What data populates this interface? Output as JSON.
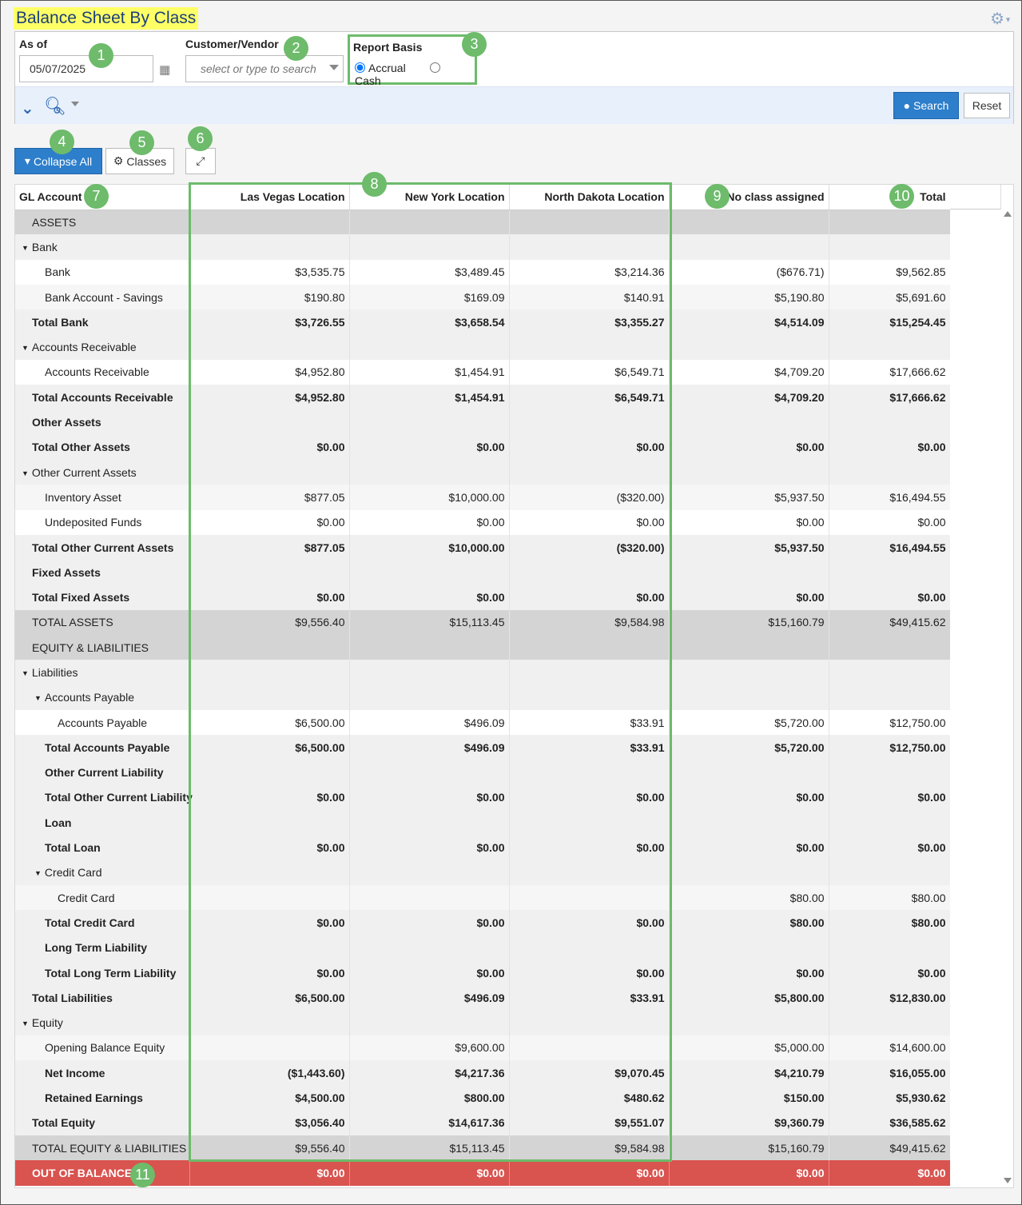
{
  "page": {
    "title": "Balance Sheet By Class"
  },
  "filters": {
    "as_of_label": "As of",
    "as_of_value": "05/07/2025",
    "customer_vendor_label": "Customer/Vendor",
    "customer_vendor_placeholder": "select or type to search",
    "report_basis_label": "Report Basis",
    "basis_options": [
      "Accrual",
      "Cash"
    ],
    "basis_selected": "Accrual",
    "search_label": "Search",
    "reset_label": "Reset"
  },
  "toolbar": {
    "collapse_all_label": "Collapse All",
    "classes_label": "Classes"
  },
  "markers": [
    "1",
    "2",
    "3",
    "4",
    "5",
    "6",
    "7",
    "8",
    "9",
    "10",
    "11"
  ],
  "table": {
    "headers": [
      "GL Account",
      "Las Vegas Location",
      "New York Location",
      "North Dakota Location",
      "No class assigned",
      "Total"
    ],
    "rows": [
      {
        "type": "sec",
        "level": 0,
        "label": "ASSETS",
        "cells": [
          "",
          "",
          "",
          "",
          ""
        ]
      },
      {
        "type": "grp",
        "level": 0,
        "toggle": true,
        "label": "Bank",
        "cells": [
          "",
          "",
          "",
          "",
          ""
        ]
      },
      {
        "type": "line",
        "level": 1,
        "label": "Bank",
        "cells": [
          "$3,535.75",
          "$3,489.45",
          "$3,214.36",
          "($676.71)",
          "$9,562.85"
        ]
      },
      {
        "type": "line alt",
        "level": 1,
        "label": "Bank Account - Savings",
        "cells": [
          "$190.80",
          "$169.09",
          "$140.91",
          "$5,190.80",
          "$5,691.60"
        ]
      },
      {
        "type": "tot",
        "level": 0,
        "label": "Total Bank",
        "cells": [
          "$3,726.55",
          "$3,658.54",
          "$3,355.27",
          "$4,514.09",
          "$15,254.45"
        ]
      },
      {
        "type": "grp",
        "level": 0,
        "toggle": true,
        "label": "Accounts Receivable",
        "cells": [
          "",
          "",
          "",
          "",
          ""
        ]
      },
      {
        "type": "line",
        "level": 1,
        "label": "Accounts Receivable",
        "cells": [
          "$4,952.80",
          "$1,454.91",
          "$6,549.71",
          "$4,709.20",
          "$17,666.62"
        ]
      },
      {
        "type": "tot",
        "level": 0,
        "label": "Total Accounts Receivable",
        "cells": [
          "$4,952.80",
          "$1,454.91",
          "$6,549.71",
          "$4,709.20",
          "$17,666.62"
        ]
      },
      {
        "type": "tot",
        "level": 0,
        "label": "Other Assets",
        "cells": [
          "",
          "",
          "",
          "",
          ""
        ]
      },
      {
        "type": "tot",
        "level": 0,
        "label": "Total Other Assets",
        "cells": [
          "$0.00",
          "$0.00",
          "$0.00",
          "$0.00",
          "$0.00"
        ]
      },
      {
        "type": "grp",
        "level": 0,
        "toggle": true,
        "label": "Other Current Assets",
        "cells": [
          "",
          "",
          "",
          "",
          ""
        ]
      },
      {
        "type": "line alt",
        "level": 1,
        "label": "Inventory Asset",
        "cells": [
          "$877.05",
          "$10,000.00",
          "($320.00)",
          "$5,937.50",
          "$16,494.55"
        ]
      },
      {
        "type": "line",
        "level": 1,
        "label": "Undeposited Funds",
        "cells": [
          "$0.00",
          "$0.00",
          "$0.00",
          "$0.00",
          "$0.00"
        ]
      },
      {
        "type": "tot",
        "level": 0,
        "label": "Total Other Current Assets",
        "cells": [
          "$877.05",
          "$10,000.00",
          "($320.00)",
          "$5,937.50",
          "$16,494.55"
        ]
      },
      {
        "type": "tot",
        "level": 0,
        "label": "Fixed Assets",
        "cells": [
          "",
          "",
          "",
          "",
          ""
        ]
      },
      {
        "type": "tot",
        "level": 0,
        "label": "Total Fixed Assets",
        "cells": [
          "$0.00",
          "$0.00",
          "$0.00",
          "$0.00",
          "$0.00"
        ]
      },
      {
        "type": "grand",
        "level": 0,
        "label": "TOTAL ASSETS",
        "cells": [
          "$9,556.40",
          "$15,113.45",
          "$9,584.98",
          "$15,160.79",
          "$49,415.62"
        ]
      },
      {
        "type": "sec",
        "level": 0,
        "label": "EQUITY & LIABILITIES",
        "cells": [
          "",
          "",
          "",
          "",
          ""
        ]
      },
      {
        "type": "grp",
        "level": 0,
        "toggle": true,
        "label": "Liabilities",
        "cells": [
          "",
          "",
          "",
          "",
          ""
        ]
      },
      {
        "type": "grp",
        "level": 1,
        "toggle": true,
        "label": "Accounts Payable",
        "cells": [
          "",
          "",
          "",
          "",
          ""
        ]
      },
      {
        "type": "line",
        "level": 2,
        "label": "Accounts Payable",
        "cells": [
          "$6,500.00",
          "$496.09",
          "$33.91",
          "$5,720.00",
          "$12,750.00"
        ]
      },
      {
        "type": "tot",
        "level": 1,
        "label": "Total Accounts Payable",
        "cells": [
          "$6,500.00",
          "$496.09",
          "$33.91",
          "$5,720.00",
          "$12,750.00"
        ]
      },
      {
        "type": "tot",
        "level": 1,
        "label": "Other Current Liability",
        "cells": [
          "",
          "",
          "",
          "",
          ""
        ]
      },
      {
        "type": "tot",
        "level": 1,
        "label": "Total Other Current Liability",
        "cells": [
          "$0.00",
          "$0.00",
          "$0.00",
          "$0.00",
          "$0.00"
        ]
      },
      {
        "type": "tot",
        "level": 1,
        "label": "Loan",
        "cells": [
          "",
          "",
          "",
          "",
          ""
        ]
      },
      {
        "type": "tot",
        "level": 1,
        "label": "Total Loan",
        "cells": [
          "$0.00",
          "$0.00",
          "$0.00",
          "$0.00",
          "$0.00"
        ]
      },
      {
        "type": "grp",
        "level": 1,
        "toggle": true,
        "label": "Credit Card",
        "cells": [
          "",
          "",
          "",
          "",
          ""
        ]
      },
      {
        "type": "line alt",
        "level": 2,
        "label": "Credit Card",
        "cells": [
          "",
          "",
          "",
          "$80.00",
          "$80.00"
        ]
      },
      {
        "type": "tot",
        "level": 1,
        "label": "Total Credit Card",
        "cells": [
          "$0.00",
          "$0.00",
          "$0.00",
          "$80.00",
          "$80.00"
        ]
      },
      {
        "type": "tot",
        "level": 1,
        "label": "Long Term Liability",
        "cells": [
          "",
          "",
          "",
          "",
          ""
        ]
      },
      {
        "type": "tot",
        "level": 1,
        "label": "Total Long Term Liability",
        "cells": [
          "$0.00",
          "$0.00",
          "$0.00",
          "$0.00",
          "$0.00"
        ]
      },
      {
        "type": "tot",
        "level": 0,
        "label": "Total Liabilities",
        "cells": [
          "$6,500.00",
          "$496.09",
          "$33.91",
          "$5,800.00",
          "$12,830.00"
        ]
      },
      {
        "type": "grp",
        "level": 0,
        "toggle": true,
        "label": "Equity",
        "cells": [
          "",
          "",
          "",
          "",
          ""
        ]
      },
      {
        "type": "line alt",
        "level": 1,
        "label": "Opening Balance Equity",
        "cells": [
          "",
          "$9,600.00",
          "",
          "$5,000.00",
          "$14,600.00"
        ]
      },
      {
        "type": "tot",
        "level": 1,
        "label": "Net Income",
        "cells": [
          "($1,443.60)",
          "$4,217.36",
          "$9,070.45",
          "$4,210.79",
          "$16,055.00"
        ]
      },
      {
        "type": "tot",
        "level": 1,
        "label": "Retained Earnings",
        "cells": [
          "$4,500.00",
          "$800.00",
          "$480.62",
          "$150.00",
          "$5,930.62"
        ]
      },
      {
        "type": "tot",
        "level": 0,
        "label": "Total Equity",
        "cells": [
          "$3,056.40",
          "$14,617.36",
          "$9,551.07",
          "$9,360.79",
          "$36,585.62"
        ]
      },
      {
        "type": "grand",
        "level": 0,
        "label": "TOTAL EQUITY & LIABILITIES",
        "cells": [
          "$9,556.40",
          "$15,113.45",
          "$9,584.98",
          "$15,160.79",
          "$49,415.62"
        ]
      },
      {
        "type": "oob",
        "level": 0,
        "label": "OUT OF BALANCE",
        "cells": [
          "$0.00",
          "$0.00",
          "$0.00",
          "$0.00",
          "$0.00"
        ]
      }
    ]
  },
  "colors": {
    "accent": "#2d7ecb",
    "marker_green": "#6dbb6b",
    "title_highlight": "#ffff66",
    "out_of_balance": "#d9534f"
  }
}
